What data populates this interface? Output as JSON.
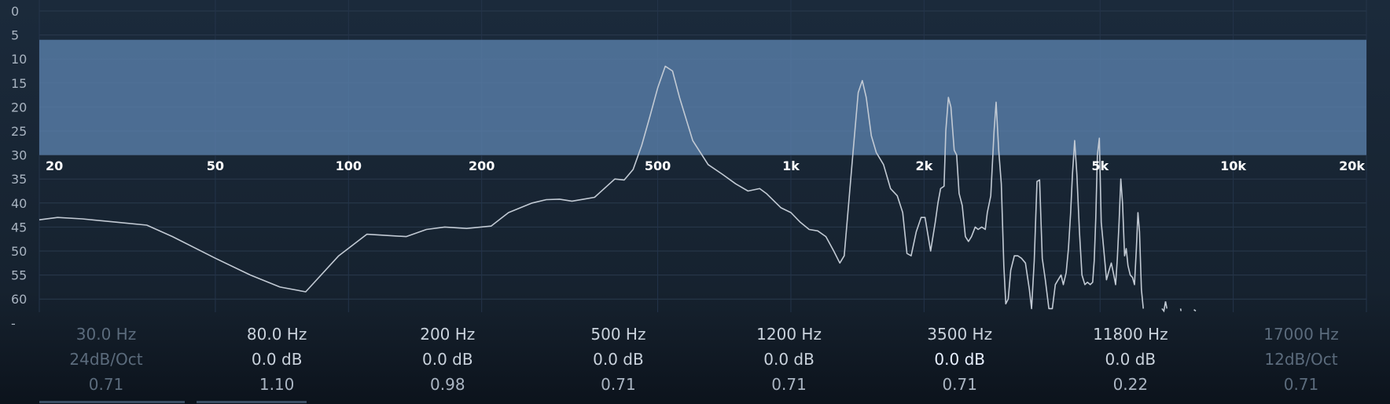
{
  "analyzer": {
    "db_labels": [
      "0",
      "5",
      "10",
      "15",
      "20",
      "25",
      "30",
      "35",
      "40",
      "45",
      "50",
      "55",
      "60",
      "-"
    ],
    "freq_labels": [
      "20",
      "50",
      "100",
      "200",
      "500",
      "1k",
      "2k",
      "5k",
      "10k",
      "20k"
    ],
    "freq_values": [
      20,
      50,
      100,
      200,
      500,
      1000,
      2000,
      5000,
      10000,
      20000
    ],
    "db_range": [
      0,
      60
    ],
    "overlay_range_db": [
      6,
      30
    ],
    "overlay_color": "#5b82ad",
    "spectrum_color": "#c2cad4",
    "spectrum": [
      [
        20,
        43.5
      ],
      [
        22,
        43
      ],
      [
        25,
        43.3
      ],
      [
        30,
        44
      ],
      [
        35,
        44.6
      ],
      [
        40,
        47
      ],
      [
        50,
        51.5
      ],
      [
        60,
        55
      ],
      [
        70,
        57.5
      ],
      [
        80,
        58.5
      ],
      [
        95,
        51
      ],
      [
        110,
        46.5
      ],
      [
        135,
        47
      ],
      [
        150,
        45.5
      ],
      [
        165,
        45
      ],
      [
        185,
        45.3
      ],
      [
        210,
        44.8
      ],
      [
        230,
        42
      ],
      [
        260,
        40
      ],
      [
        280,
        39.3
      ],
      [
        300,
        39.2
      ],
      [
        320,
        39.6
      ],
      [
        340,
        39.2
      ],
      [
        360,
        38.8
      ],
      [
        400,
        35
      ],
      [
        420,
        35.2
      ],
      [
        440,
        33
      ],
      [
        460,
        28
      ],
      [
        480,
        22
      ],
      [
        500,
        16
      ],
      [
        520,
        11.5
      ],
      [
        540,
        12.5
      ],
      [
        560,
        18
      ],
      [
        600,
        27
      ],
      [
        650,
        32
      ],
      [
        700,
        34
      ],
      [
        750,
        36
      ],
      [
        800,
        37.5
      ],
      [
        850,
        37
      ],
      [
        880,
        38
      ],
      [
        950,
        41
      ],
      [
        1000,
        42
      ],
      [
        1050,
        44
      ],
      [
        1100,
        45.5
      ],
      [
        1150,
        45.8
      ],
      [
        1200,
        47
      ],
      [
        1250,
        50
      ],
      [
        1290,
        52.5
      ],
      [
        1320,
        51
      ],
      [
        1380,
        30
      ],
      [
        1420,
        17
      ],
      [
        1450,
        14.5
      ],
      [
        1480,
        18
      ],
      [
        1520,
        26
      ],
      [
        1560,
        29.5
      ],
      [
        1620,
        32
      ],
      [
        1680,
        37
      ],
      [
        1740,
        38.5
      ],
      [
        1790,
        42
      ],
      [
        1830,
        50.5
      ],
      [
        1870,
        51
      ],
      [
        1920,
        46
      ],
      [
        1970,
        43
      ],
      [
        2010,
        43
      ],
      [
        2070,
        50
      ],
      [
        2120,
        44
      ],
      [
        2150,
        40
      ],
      [
        2180,
        37
      ],
      [
        2220,
        36.5
      ],
      [
        2240,
        25
      ],
      [
        2270,
        18
      ],
      [
        2300,
        20
      ],
      [
        2340,
        29
      ],
      [
        2370,
        30
      ],
      [
        2400,
        38
      ],
      [
        2440,
        40.5
      ],
      [
        2480,
        47
      ],
      [
        2520,
        48
      ],
      [
        2560,
        47
      ],
      [
        2610,
        45
      ],
      [
        2650,
        45.5
      ],
      [
        2700,
        45
      ],
      [
        2750,
        45.5
      ],
      [
        2780,
        42
      ],
      [
        2830,
        38.5
      ],
      [
        2880,
        25
      ],
      [
        2910,
        19
      ],
      [
        2950,
        29
      ],
      [
        2990,
        36
      ],
      [
        3030,
        53
      ],
      [
        3060,
        61
      ],
      [
        3100,
        60
      ],
      [
        3140,
        54
      ],
      [
        3200,
        51
      ],
      [
        3260,
        51
      ],
      [
        3320,
        51.5
      ],
      [
        3390,
        52.5
      ],
      [
        3460,
        58
      ],
      [
        3500,
        62
      ],
      [
        3550,
        52
      ],
      [
        3600,
        35.5
      ],
      [
        3650,
        35.2
      ],
      [
        3700,
        51.5
      ],
      [
        3760,
        56
      ],
      [
        3830,
        62
      ],
      [
        3900,
        62
      ],
      [
        3960,
        57
      ],
      [
        4020,
        56
      ],
      [
        4080,
        55
      ],
      [
        4130,
        57
      ],
      [
        4190,
        54.5
      ],
      [
        4240,
        49.5
      ],
      [
        4290,
        42
      ],
      [
        4330,
        34
      ],
      [
        4380,
        27
      ],
      [
        4430,
        34
      ],
      [
        4490,
        46
      ],
      [
        4550,
        55
      ],
      [
        4620,
        57
      ],
      [
        4680,
        56.5
      ],
      [
        4750,
        57
      ],
      [
        4810,
        56.5
      ],
      [
        4850,
        52
      ],
      [
        4890,
        43
      ],
      [
        4930,
        30
      ],
      [
        4980,
        26.5
      ],
      [
        5030,
        44
      ],
      [
        5100,
        50
      ],
      [
        5170,
        56
      ],
      [
        5240,
        54
      ],
      [
        5300,
        52.5
      ],
      [
        5370,
        55
      ],
      [
        5420,
        57
      ],
      [
        5470,
        51.5
      ],
      [
        5520,
        44
      ],
      [
        5570,
        35
      ],
      [
        5620,
        40
      ],
      [
        5680,
        51
      ],
      [
        5730,
        49.5
      ],
      [
        5780,
        53
      ],
      [
        5850,
        55
      ],
      [
        5920,
        55.5
      ],
      [
        5980,
        57
      ],
      [
        6040,
        49.5
      ],
      [
        6090,
        42
      ],
      [
        6140,
        46
      ],
      [
        6200,
        58
      ],
      [
        6260,
        62
      ]
    ],
    "spectrum_tail": [
      [
        [
          6900,
          62
        ],
        [
          6970,
          62.5
        ],
        [
          7030,
          60.5
        ],
        [
          7080,
          62
        ]
      ],
      [
        [
          7600,
          62
        ],
        [
          7620,
          62.5
        ]
      ],
      [
        [
          8150,
          62.2
        ],
        [
          8230,
          62.5
        ]
      ]
    ]
  },
  "bands": [
    {
      "freq": "30.0 Hz",
      "gain": "24dB/Oct",
      "q": "0.71",
      "state": "dim"
    },
    {
      "freq": "80.0 Hz",
      "gain": "0.0 dB",
      "q": "1.10",
      "state": "normal"
    },
    {
      "freq": "200 Hz",
      "gain": "0.0 dB",
      "q": "0.98",
      "state": "normal"
    },
    {
      "freq": "500 Hz",
      "gain": "0.0 dB",
      "q": "0.71",
      "state": "normal"
    },
    {
      "freq": "1200 Hz",
      "gain": "0.0 dB",
      "q": "0.71",
      "state": "normal"
    },
    {
      "freq": "3500 Hz",
      "gain": "0.0 dB",
      "q": "0.71",
      "state": "active"
    },
    {
      "freq": "11800 Hz",
      "gain": "0.0 dB",
      "q": "0.22",
      "state": "normal"
    },
    {
      "freq": "17000 Hz",
      "gain": "12dB/Oct",
      "q": "0.71",
      "state": "dim"
    }
  ]
}
